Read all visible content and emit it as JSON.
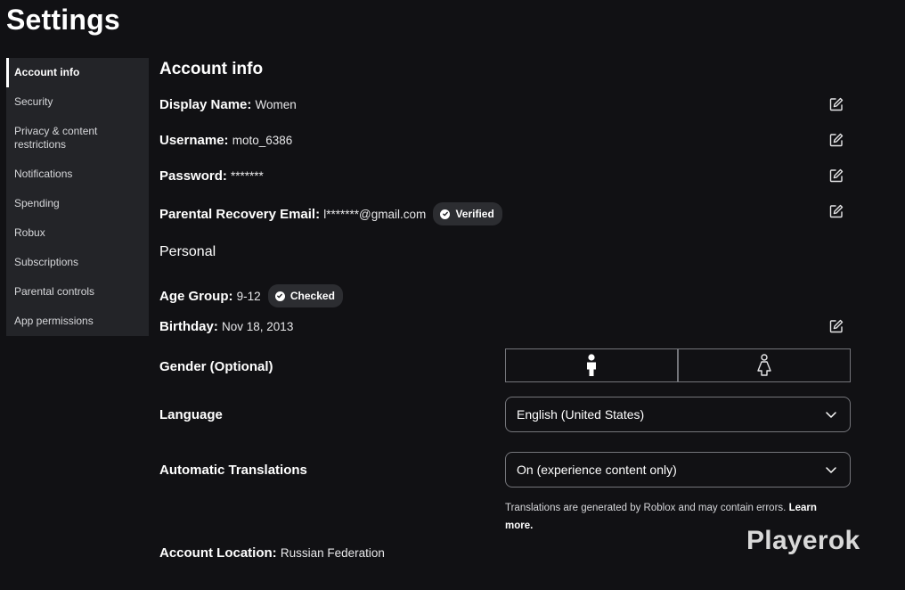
{
  "page_title": "Settings",
  "sidebar": {
    "items": [
      {
        "label": "Account info",
        "active": true
      },
      {
        "label": "Security"
      },
      {
        "label": "Privacy & content restrictions"
      },
      {
        "label": "Notifications"
      },
      {
        "label": "Spending"
      },
      {
        "label": "Robux"
      },
      {
        "label": "Subscriptions"
      },
      {
        "label": "Parental controls"
      },
      {
        "label": "App permissions"
      }
    ]
  },
  "account": {
    "section_title": "Account info",
    "display_name": {
      "label": "Display Name:",
      "value": "Women"
    },
    "username": {
      "label": "Username:",
      "value": "moto_6386"
    },
    "password": {
      "label": "Password:",
      "value": "*******"
    },
    "parental_email": {
      "label": "Parental Recovery Email:",
      "value": "l*******@gmail.com",
      "badge": "Verified"
    },
    "personal_heading": "Personal",
    "age_group": {
      "label": "Age Group:",
      "value": "9-12",
      "badge": "Checked"
    },
    "birthday": {
      "label": "Birthday:",
      "value": "Nov 18, 2013"
    },
    "gender": {
      "label": "Gender (Optional)",
      "options": [
        "male-icon",
        "female-icon"
      ]
    },
    "language": {
      "label": "Language",
      "selected": "English (United States)"
    },
    "translations": {
      "label": "Automatic Translations",
      "selected": "On (experience content only)",
      "note": "Translations are generated by Roblox and may contain errors.",
      "learn_more": "Learn more."
    },
    "location": {
      "label": "Account Location:",
      "value": "Russian Federation"
    }
  },
  "icons": {
    "edit": "edit-pencil-icon",
    "check": "check-circle-icon",
    "dropdown": "chevron-down-icon"
  },
  "watermark": "Playerok"
}
